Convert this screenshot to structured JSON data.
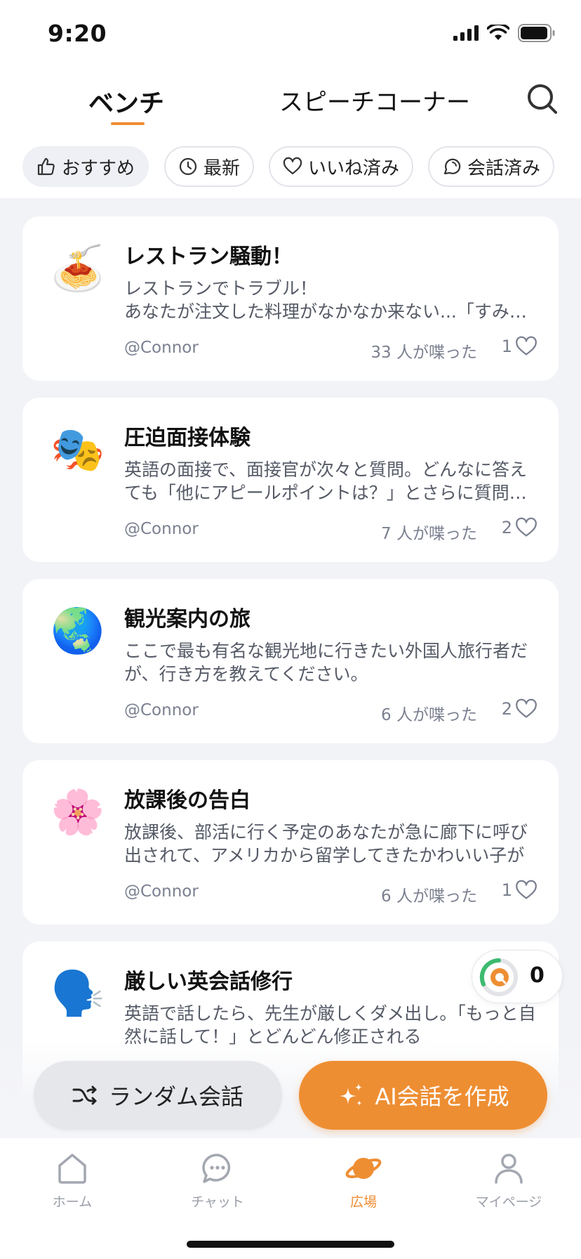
{
  "status": {
    "time": "9:20"
  },
  "header": {
    "tabs": [
      {
        "label": "ベンチ",
        "active": true
      },
      {
        "label": "スピーチコーナー",
        "active": false
      }
    ],
    "search_icon": "search-icon"
  },
  "filters": [
    {
      "label": "おすすめ",
      "icon": "thumbs-up-icon",
      "active": true
    },
    {
      "label": "最新",
      "icon": "clock-icon",
      "active": false
    },
    {
      "label": "いいね済み",
      "icon": "heart-icon",
      "active": false
    },
    {
      "label": "会話済み",
      "icon": "chat-bubble-icon",
      "active": false
    }
  ],
  "cards": [
    {
      "emoji": "🍝",
      "title": "レストラン騒動！",
      "description": "レストランでトラブル！\nあなたが注文した料理がなかなか来ない...「すみません」",
      "author": "@Connor",
      "talked": "33 人が喋った",
      "likes": "1"
    },
    {
      "emoji": "🎭",
      "title": "圧迫面接体験",
      "description": "英語の面接で、面接官が次々と質問。どんなに答えても「他にアピールポイントは？」とさらに質問される",
      "author": "@Connor",
      "talked": "7 人が喋った",
      "likes": "2"
    },
    {
      "emoji": "🌏",
      "title": "観光案内の旅",
      "description": "ここで最も有名な観光地に行きたい外国人旅行者だが、行き方を教えてください。",
      "author": "@Connor",
      "talked": "6 人が喋った",
      "likes": "2"
    },
    {
      "emoji": "🌸",
      "title": "放課後の告白",
      "description": "放課後、部活に行く予定のあなたが急に廊下に呼び出されて、アメリカから留学してきたかわいい子が",
      "author": "@Connor",
      "talked": "6 人が喋った",
      "likes": "1"
    },
    {
      "emoji": "🗣️",
      "title": "厳しい英会話修行",
      "description": "英語で話したら、先生が厳しくダメ出し。「もっと自然に話して！」とどんどん修正される",
      "author": "",
      "talked": "",
      "likes": ""
    }
  ],
  "points": {
    "count": "0"
  },
  "actions": {
    "random_label": "ランダム会話",
    "create_label": "AI会話を作成"
  },
  "tabbar": [
    {
      "label": "ホーム",
      "icon": "home-icon",
      "active": false
    },
    {
      "label": "チャット",
      "icon": "chat-icon",
      "active": false
    },
    {
      "label": "広場",
      "icon": "planet-icon",
      "active": true
    },
    {
      "label": "マイページ",
      "icon": "person-icon",
      "active": false
    }
  ],
  "colors": {
    "accent": "#ee8e33",
    "background": "#f2f3f7",
    "muted": "#7b8090"
  }
}
